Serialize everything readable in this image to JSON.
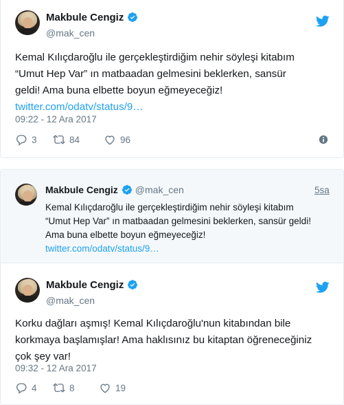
{
  "tweet1": {
    "author_name": "Makbule Cengiz",
    "author_handle": "@mak_cen",
    "text_lines": [
      "Kemal Kılıçdaroğlu ile gerçekleştirdiğim nehir söyleşi kitabım",
      "“Umut Hep Var” ın matbaadan gelmesini beklerken, sansür",
      "geldi! Ama buna elbette boyun eğmeyeceğiz!"
    ],
    "link": "twitter.com/odatv/status/9…",
    "timestamp": "09:22 - 12 Ara 2017",
    "reply_count": "3",
    "retweet_count": "84",
    "like_count": "96"
  },
  "quoted_tweet": {
    "author_name": "Makbule Cengiz",
    "author_handle": "@mak_cen",
    "relative_time": "5sa",
    "text_lines": [
      "Kemal Kılıçdaroğlu ile gerçekleştirdiğim nehir söyleşi kitabım",
      "“Umut Hep Var” ın matbaadan gelmesini beklerken, sansür geldi!",
      "Ama buna elbette boyun eğmeyeceğiz!"
    ],
    "link": "twitter.com/odatv/status/9…"
  },
  "tweet2": {
    "author_name": "Makbule Cengiz",
    "author_handle": "@mak_cen",
    "text_lines": [
      "Korku dağları aşmış! Kemal Kılıçdaroğlu'nun kitabından bile",
      "korkmaya başlamışlar! Ama haklısınız bu kitaptan öğreneceğiniz",
      "çok şey var!"
    ],
    "timestamp": "09:32 - 12 Ara 2017",
    "reply_count": "4",
    "retweet_count": "8",
    "like_count": "19"
  },
  "colors": {
    "twitter_blue": "#1da1f2",
    "text_primary": "#14171a",
    "text_secondary": "#657786",
    "border": "#e6ecf0",
    "quoted_bg": "#f5f8fa"
  },
  "icons": [
    "verified-badge-icon",
    "twitter-bird-icon",
    "reply-icon",
    "retweet-icon",
    "like-icon",
    "info-icon"
  ]
}
